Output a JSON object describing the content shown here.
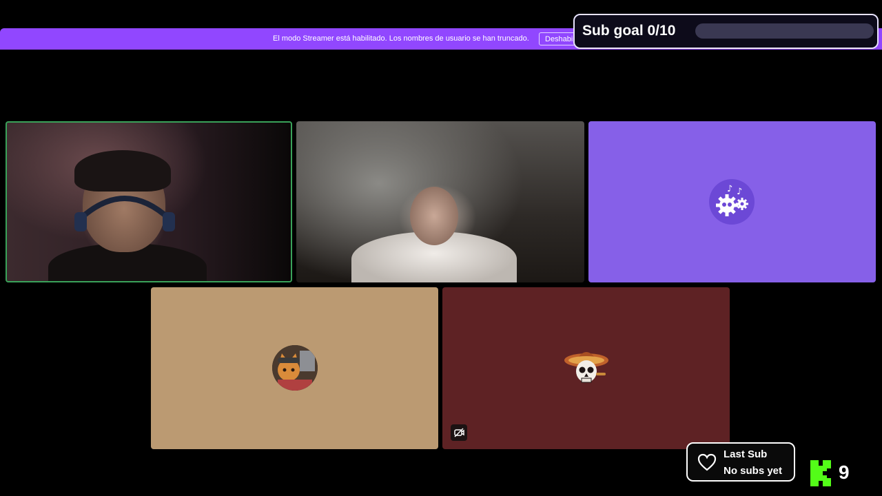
{
  "banner": {
    "text": "El modo Streamer está habilitado. Los nombres de usuario se han truncado.",
    "button_label": "Deshabilitar",
    "color": "#9147ff"
  },
  "sub_goal": {
    "label": "Sub goal 0/10",
    "current": 0,
    "target": 10,
    "progress_fraction": 0.0
  },
  "tiles": [
    {
      "kind": "webcam",
      "active_speaker": true,
      "accent": "#3aa35a"
    },
    {
      "kind": "webcam",
      "active_speaker": false
    },
    {
      "kind": "avatar",
      "icon": "gears-music-icon",
      "background": "#8660e8"
    },
    {
      "kind": "avatar",
      "icon": "cat-avatar-icon",
      "background": "#bb9a72"
    },
    {
      "kind": "avatar",
      "icon": "skull-sombrero-icon",
      "background": "#5e2224",
      "muted_indicator": "camera-off-icon"
    }
  ],
  "last_sub": {
    "title": "Last Sub",
    "value": "No subs yet",
    "icon": "heart-icon"
  },
  "kick": {
    "logo": "kick-logo-icon",
    "brand_color": "#53fc18",
    "viewer_count": "9"
  }
}
